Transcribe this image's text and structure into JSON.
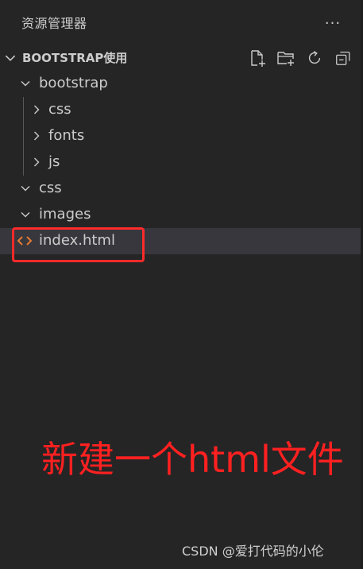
{
  "explorer": {
    "title": "资源管理器",
    "more_actions": "···",
    "section": {
      "label": "BOOTSTRAP使用",
      "actions": [
        "new-file-icon",
        "new-folder-icon",
        "refresh-icon",
        "collapse-all-icon"
      ]
    },
    "tree": [
      {
        "label": "bootstrap",
        "type": "folder",
        "expanded": true
      },
      {
        "label": "css",
        "type": "folder",
        "expanded": false
      },
      {
        "label": "fonts",
        "type": "folder",
        "expanded": false
      },
      {
        "label": "js",
        "type": "folder",
        "expanded": false
      },
      {
        "label": "css",
        "type": "folder",
        "expanded": true
      },
      {
        "label": "images",
        "type": "folder",
        "expanded": true
      },
      {
        "label": "index.html",
        "type": "file",
        "selected": true
      }
    ]
  },
  "annotation": {
    "text": "新建一个html文件"
  },
  "watermark": {
    "text": "CSDN @爱打代码的小伦"
  },
  "colors": {
    "background": "#252526",
    "text": "#cccccc",
    "selected_row": "#37373d",
    "annotation_red": "#ff2020",
    "html_icon": "#e37933"
  }
}
